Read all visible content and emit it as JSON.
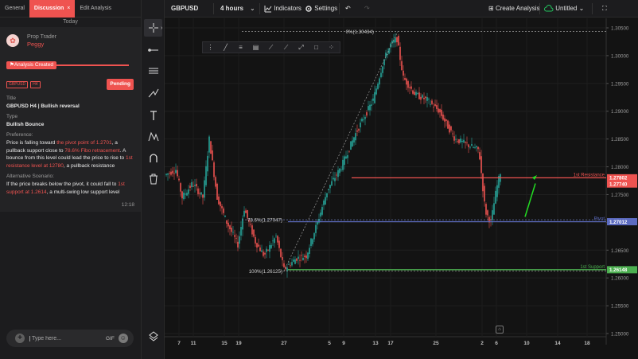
{
  "left_panel": {
    "tabs": [
      {
        "label": "General"
      },
      {
        "label": "Discussion",
        "close": "×"
      },
      {
        "label": "Edit Analysis"
      }
    ],
    "day_label": "Today",
    "author": {
      "role": "Prop Trader",
      "name": "Peggy"
    },
    "status": "Analysis Created",
    "badges": [
      "GBPUSD",
      "H4"
    ],
    "pending": "Pending",
    "title_label": "Title",
    "title_value": "GBPUSD H4 | Bullish reversal",
    "type_label": "Type",
    "type_value": "Bullish Bounce",
    "preference_label": "Preference:",
    "preference_parts": [
      "Price is falling toward ",
      "the pivot point of 1.2701",
      ", a pullback support close to ",
      "78.6% Fibo retracement",
      ". A bounce from this level could lead the price to rise to ",
      "1st resistance level at 12780",
      ", a pullback  resistance"
    ],
    "alt_label": "Alternative Scenario:",
    "alt_parts": [
      "If the price breaks below the pivot, it could fall  to ",
      "1st support at 1.2614",
      ", a multi-swing low support  level"
    ],
    "time": "12:18",
    "compose": {
      "placeholder": "Type here...",
      "gif": "GIF",
      "plus": "+"
    }
  },
  "toolbar": {
    "symbol": "GBPUSD",
    "interval": "4 hours",
    "indicators": "Indicators",
    "settings": "Settings",
    "create_analysis": "Create Analysis",
    "layout_name": "Untitled"
  },
  "chart": {
    "price_labels": [
      "1.30500",
      "1.30000",
      "1.29500",
      "1.29000",
      "1.28500",
      "1.28000",
      "1.27500",
      "1.27000",
      "1.26500",
      "1.26000",
      "1.25500",
      "1.25000"
    ],
    "date_labels": [
      "7",
      "11",
      "15",
      "19",
      "27",
      "5",
      "9",
      "13",
      "17",
      "25",
      "2",
      "6",
      "10",
      "14",
      "18"
    ],
    "fib_labels": [
      "0%(1.30434)",
      "78.6%(1.27047)",
      "100%(1.26125)"
    ],
    "levels": [
      {
        "name": "1st Resistance",
        "value": "1.27802",
        "color": "#ef5350"
      },
      {
        "name": "Pivot",
        "value": "1.27012",
        "color": "#5c6bc0"
      },
      {
        "name": "1st Support",
        "value": "1.26148",
        "color": "#4caf50"
      }
    ],
    "current_price": "1.27740",
    "colors": {
      "up": "#26a69a",
      "down": "#ef5350",
      "arrow": "#22dd22"
    }
  }
}
